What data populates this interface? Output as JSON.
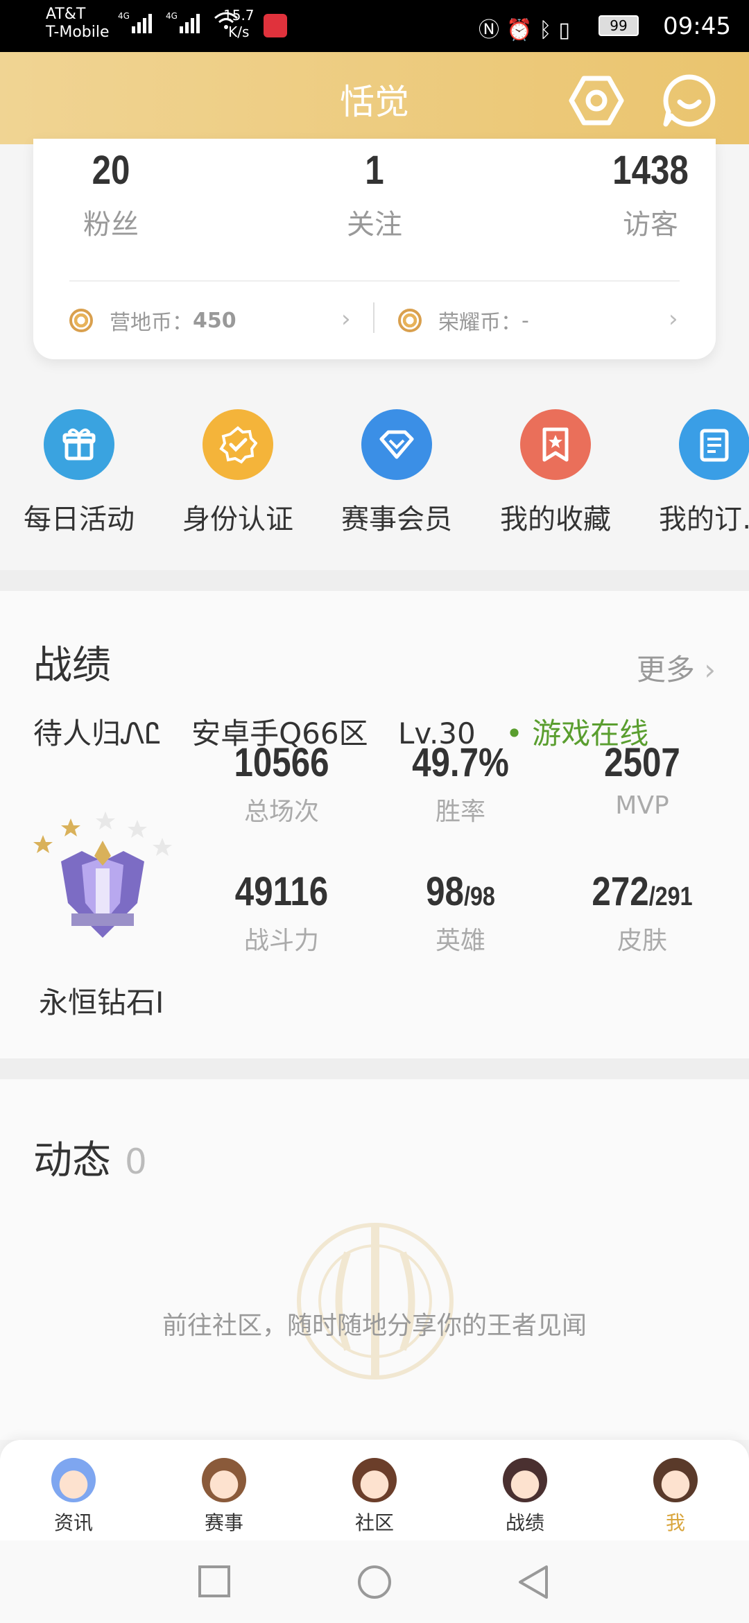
{
  "status_bar": {
    "carrier_line1": "AT&T",
    "carrier_line2": "T-Mobile",
    "net1": "4G",
    "net2": "4G",
    "speed_value": "15.7",
    "speed_unit": "K/s",
    "battery": "99",
    "time": "09:45"
  },
  "header": {
    "title": "恬觉",
    "settings_icon": "hexagon-settings-icon",
    "message_icon": "chat-bubble-icon"
  },
  "profile": {
    "stats": [
      {
        "value": "20",
        "label": "粉丝"
      },
      {
        "value": "1",
        "label": "关注"
      },
      {
        "value": "1438",
        "label": "访客"
      }
    ],
    "coins": [
      {
        "label": "营地币：",
        "value": "450"
      },
      {
        "label": "荣耀币：",
        "value": "-"
      }
    ]
  },
  "shortcuts": [
    {
      "label": "每日活动",
      "color": "#3aa3e0",
      "icon": "gift-icon"
    },
    {
      "label": "身份认证",
      "color": "#f4b43a",
      "icon": "verified-badge-icon"
    },
    {
      "label": "赛事会员",
      "color": "#3b8fe6",
      "icon": "diamond-icon"
    },
    {
      "label": "我的收藏",
      "color": "#ea6f5a",
      "icon": "bookmark-star-icon"
    },
    {
      "label": "我的订…",
      "color": "#3a9ee6",
      "icon": "clipboard-icon"
    }
  ],
  "records": {
    "title": "战绩",
    "more": "更多",
    "player_name": "待人归ᏁᏝ",
    "server": "安卓手Q66区",
    "level": "Lv.30",
    "online": "游戏在线",
    "rank_name": "永恒钻石I",
    "stats": [
      {
        "value": "10566",
        "label": "总场次"
      },
      {
        "value": "49.7%",
        "label": "胜率"
      },
      {
        "value": "2507",
        "label": "MVP"
      },
      {
        "value": "49116",
        "label": "战斗力"
      },
      {
        "value": "98",
        "sub": "/98",
        "label": "英雄"
      },
      {
        "value": "272",
        "sub": "/291",
        "label": "皮肤"
      }
    ]
  },
  "dynamics": {
    "title": "动态",
    "count": "0",
    "empty_text": "前往社区，随时随地分享你的王者见闻"
  },
  "tabs": [
    {
      "label": "资讯"
    },
    {
      "label": "赛事"
    },
    {
      "label": "社区"
    },
    {
      "label": "战绩"
    },
    {
      "label": "我"
    }
  ],
  "colors": {
    "header_gradient_start": "#f0d493",
    "header_gradient_end": "#eac46e",
    "online_green": "#5a9e2f",
    "active_tab": "#d9a63e"
  }
}
